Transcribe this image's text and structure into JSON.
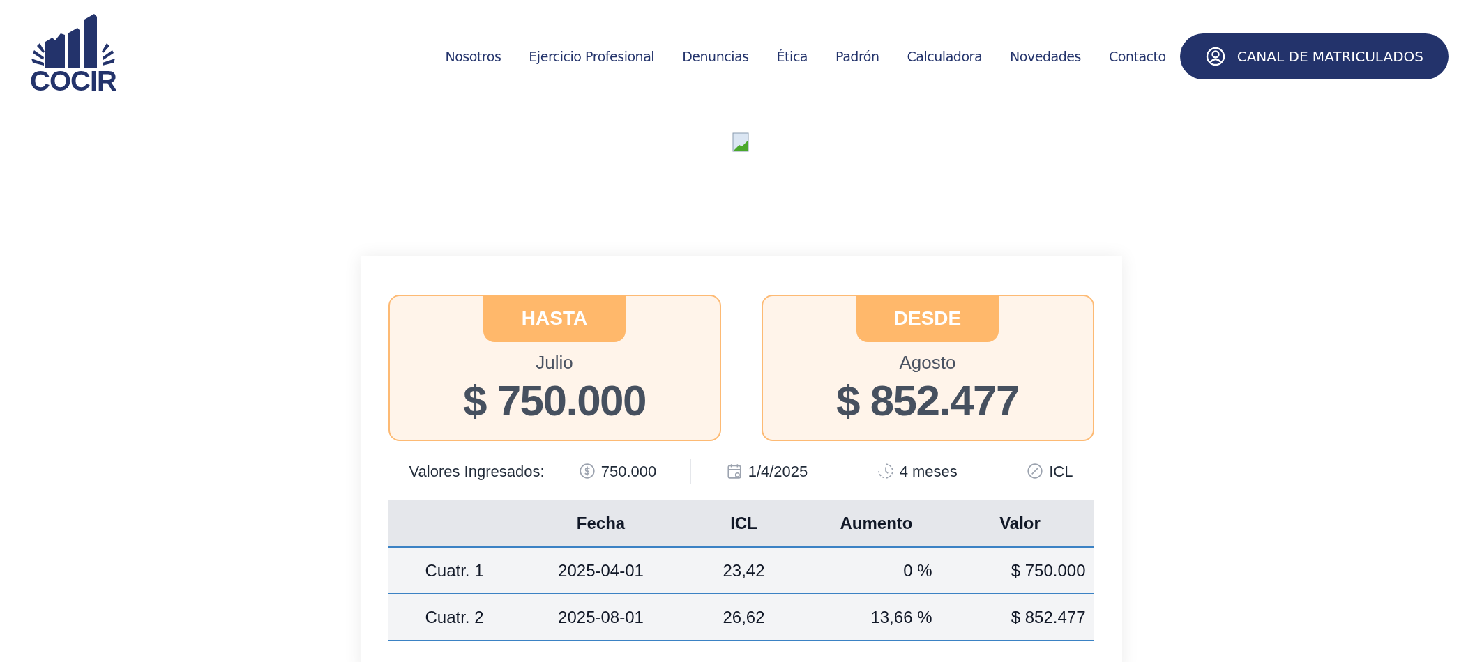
{
  "logo": {
    "text": "COCIR"
  },
  "nav": {
    "items": [
      "Nosotros",
      "Ejercicio Profesional",
      "Denuncias",
      "Ética",
      "Padrón",
      "Calculadora",
      "Novedades",
      "Contacto"
    ],
    "button": "CANAL DE MATRICULADOS"
  },
  "cards": [
    {
      "tab": "HASTA",
      "month": "Julio",
      "amount": "$ 750.000"
    },
    {
      "tab": "DESDE",
      "month": "Agosto",
      "amount": "$ 852.477"
    }
  ],
  "summary": {
    "label": "Valores Ingresados:",
    "items": [
      {
        "kind": "money",
        "text": "750.000"
      },
      {
        "kind": "date",
        "text": "1/4/2025"
      },
      {
        "kind": "duration",
        "text": "4 meses"
      },
      {
        "kind": "index",
        "text": "ICL"
      }
    ]
  },
  "table": {
    "columns": [
      "",
      "Fecha",
      "ICL",
      "Aumento",
      "Valor"
    ],
    "rows": [
      [
        "Cuatr. 1",
        "2025-04-01",
        "23,42",
        "0 %",
        "$ 750.000"
      ],
      [
        "Cuatr. 2",
        "2025-08-01",
        "26,62",
        "13,66 %",
        "$ 852.477"
      ]
    ]
  }
}
